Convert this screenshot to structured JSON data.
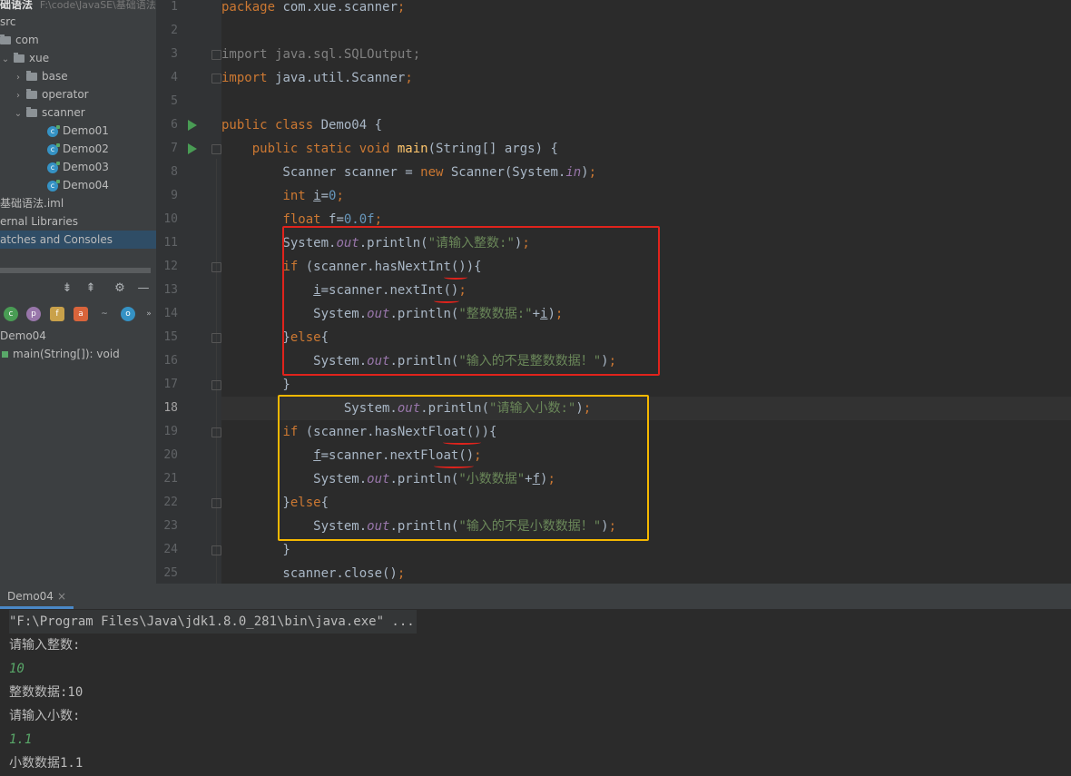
{
  "project_tree": {
    "header_title": "础语法",
    "header_path": "F:\\code\\JavaSE\\基础语法",
    "items": [
      {
        "label": "src"
      },
      {
        "label": "com"
      },
      {
        "label": "xue"
      },
      {
        "label": "base"
      },
      {
        "label": "operator"
      },
      {
        "label": "scanner"
      },
      {
        "label": "Demo01"
      },
      {
        "label": "Demo02"
      },
      {
        "label": "Demo03"
      },
      {
        "label": "Demo04"
      },
      {
        "label": "基础语法.iml"
      },
      {
        "label": "ernal Libraries"
      },
      {
        "label": "atches and Consoles"
      }
    ]
  },
  "structure": {
    "class_name": "Demo04",
    "method": "main(String[]): void",
    "filter_icons": [
      "c",
      "p",
      "f",
      "a",
      "~",
      "o"
    ],
    "toolbar_icons": [
      "expand-all-icon",
      "collapse-all-icon",
      "gear-icon",
      "minimize-icon"
    ],
    "more": "»"
  },
  "editor": {
    "line_numbers": [
      "1",
      "2",
      "3",
      "4",
      "5",
      "6",
      "7",
      "8",
      "9",
      "10",
      "11",
      "12",
      "13",
      "14",
      "15",
      "16",
      "17",
      "18",
      "19",
      "20",
      "21",
      "22",
      "23",
      "24",
      "25"
    ],
    "current_line": "18",
    "run_lines": [
      "6",
      "7"
    ],
    "lines": [
      {
        "tokens": [
          {
            "t": "package ",
            "c": "kw"
          },
          {
            "t": "com.xue.scanner",
            "c": ""
          },
          {
            "t": ";",
            "c": "kw"
          }
        ]
      },
      {
        "tokens": []
      },
      {
        "tokens": [
          {
            "t": "import ",
            "c": "gray"
          },
          {
            "t": "java.sql.SQLOutput",
            "c": "gray"
          },
          {
            "t": ";",
            "c": "gray"
          }
        ]
      },
      {
        "tokens": [
          {
            "t": "import ",
            "c": "kw"
          },
          {
            "t": "java.util.Scanner",
            "c": ""
          },
          {
            "t": ";",
            "c": "kw"
          }
        ]
      },
      {
        "tokens": []
      },
      {
        "tokens": [
          {
            "t": "public class ",
            "c": "kw"
          },
          {
            "t": "Demo04 {",
            "c": ""
          }
        ]
      },
      {
        "tokens": [
          {
            "t": "    public static void ",
            "c": "kw"
          },
          {
            "t": "main",
            "c": "fn"
          },
          {
            "t": "(String[] args) {",
            "c": ""
          }
        ]
      },
      {
        "tokens": [
          {
            "t": "        Scanner scanner = ",
            "c": ""
          },
          {
            "t": "new ",
            "c": "kw"
          },
          {
            "t": "Scanner(System.",
            "c": ""
          },
          {
            "t": "in",
            "c": "ital"
          },
          {
            "t": ")",
            "c": ""
          },
          {
            "t": ";",
            "c": "kw"
          }
        ]
      },
      {
        "tokens": [
          {
            "t": "        ",
            "c": ""
          },
          {
            "t": "int ",
            "c": "kw"
          },
          {
            "t": "i",
            "c": "ul"
          },
          {
            "t": "=",
            "c": ""
          },
          {
            "t": "0",
            "c": "num"
          },
          {
            "t": ";",
            "c": "kw"
          }
        ]
      },
      {
        "tokens": [
          {
            "t": "        ",
            "c": ""
          },
          {
            "t": "float ",
            "c": "kw"
          },
          {
            "t": "f=",
            "c": ""
          },
          {
            "t": "0.0f",
            "c": "num"
          },
          {
            "t": ";",
            "c": "kw"
          }
        ]
      },
      {
        "tokens": [
          {
            "t": "        System.",
            "c": ""
          },
          {
            "t": "out",
            "c": "ital"
          },
          {
            "t": ".println(",
            "c": ""
          },
          {
            "t": "\"请输入整数:\"",
            "c": "str"
          },
          {
            "t": ")",
            "c": ""
          },
          {
            "t": ";",
            "c": "kw"
          }
        ]
      },
      {
        "tokens": [
          {
            "t": "        ",
            "c": ""
          },
          {
            "t": "if ",
            "c": "kw"
          },
          {
            "t": "(scanner.hasNextInt()){",
            "c": ""
          }
        ]
      },
      {
        "tokens": [
          {
            "t": "            ",
            "c": ""
          },
          {
            "t": "i",
            "c": "ul"
          },
          {
            "t": "=scanner.nextInt()",
            "c": ""
          },
          {
            "t": ";",
            "c": "kw"
          }
        ]
      },
      {
        "tokens": [
          {
            "t": "            System.",
            "c": ""
          },
          {
            "t": "out",
            "c": "ital"
          },
          {
            "t": ".println(",
            "c": ""
          },
          {
            "t": "\"整数数据:\"",
            "c": "str"
          },
          {
            "t": "+",
            "c": ""
          },
          {
            "t": "i",
            "c": "ul"
          },
          {
            "t": ")",
            "c": ""
          },
          {
            "t": ";",
            "c": "kw"
          }
        ]
      },
      {
        "tokens": [
          {
            "t": "        }",
            "c": ""
          },
          {
            "t": "else",
            "c": "kw"
          },
          {
            "t": "{",
            "c": ""
          }
        ]
      },
      {
        "tokens": [
          {
            "t": "            System.",
            "c": ""
          },
          {
            "t": "out",
            "c": "ital"
          },
          {
            "t": ".println(",
            "c": ""
          },
          {
            "t": "\"输入的不是整数数据！\"",
            "c": "str"
          },
          {
            "t": ")",
            "c": ""
          },
          {
            "t": ";",
            "c": "kw"
          }
        ]
      },
      {
        "tokens": [
          {
            "t": "        }",
            "c": ""
          }
        ]
      },
      {
        "tokens": [
          {
            "t": "                System.",
            "c": ""
          },
          {
            "t": "out",
            "c": "ital"
          },
          {
            "t": ".println(",
            "c": ""
          },
          {
            "t": "\"请输入小数:\"",
            "c": "str"
          },
          {
            "t": ")",
            "c": ""
          },
          {
            "t": ";",
            "c": "kw"
          }
        ]
      },
      {
        "tokens": [
          {
            "t": "        ",
            "c": ""
          },
          {
            "t": "if ",
            "c": "kw"
          },
          {
            "t": "(scanner.hasNextFloat()){",
            "c": ""
          }
        ]
      },
      {
        "tokens": [
          {
            "t": "            ",
            "c": ""
          },
          {
            "t": "f",
            "c": "ul"
          },
          {
            "t": "=scanner.nextFloat()",
            "c": ""
          },
          {
            "t": ";",
            "c": "kw"
          }
        ]
      },
      {
        "tokens": [
          {
            "t": "            System.",
            "c": ""
          },
          {
            "t": "out",
            "c": "ital"
          },
          {
            "t": ".println(",
            "c": ""
          },
          {
            "t": "\"小数数据\"",
            "c": "str"
          },
          {
            "t": "+",
            "c": ""
          },
          {
            "t": "f",
            "c": "ul"
          },
          {
            "t": ")",
            "c": ""
          },
          {
            "t": ";",
            "c": "kw"
          }
        ]
      },
      {
        "tokens": [
          {
            "t": "        }",
            "c": ""
          },
          {
            "t": "else",
            "c": "kw"
          },
          {
            "t": "{",
            "c": ""
          }
        ]
      },
      {
        "tokens": [
          {
            "t": "            System.",
            "c": ""
          },
          {
            "t": "out",
            "c": "ital"
          },
          {
            "t": ".println(",
            "c": ""
          },
          {
            "t": "\"输入的不是小数数据！\"",
            "c": "str"
          },
          {
            "t": ")",
            "c": ""
          },
          {
            "t": ";",
            "c": "kw"
          }
        ]
      },
      {
        "tokens": [
          {
            "t": "        }",
            "c": ""
          }
        ]
      },
      {
        "tokens": [
          {
            "t": "        scanner.close()",
            "c": ""
          },
          {
            "t": ";",
            "c": "kw"
          }
        ]
      }
    ]
  },
  "console": {
    "tab_label": "Demo04",
    "tab_close": "×",
    "lines": [
      {
        "text": "\"F:\\Program Files\\Java\\jdk1.8.0_281\\bin\\java.exe\" ...",
        "kind": "cmd"
      },
      {
        "text": "请输入整数:",
        "kind": "out"
      },
      {
        "text": "10",
        "kind": "input"
      },
      {
        "text": "整数数据:10",
        "kind": "out"
      },
      {
        "text": "请输入小数:",
        "kind": "out"
      },
      {
        "text": "1.1",
        "kind": "input"
      },
      {
        "text": "小数数据1.1",
        "kind": "out"
      }
    ]
  },
  "colors": {
    "highlight_red": "#e0231c",
    "highlight_yellow": "#f5b800"
  }
}
